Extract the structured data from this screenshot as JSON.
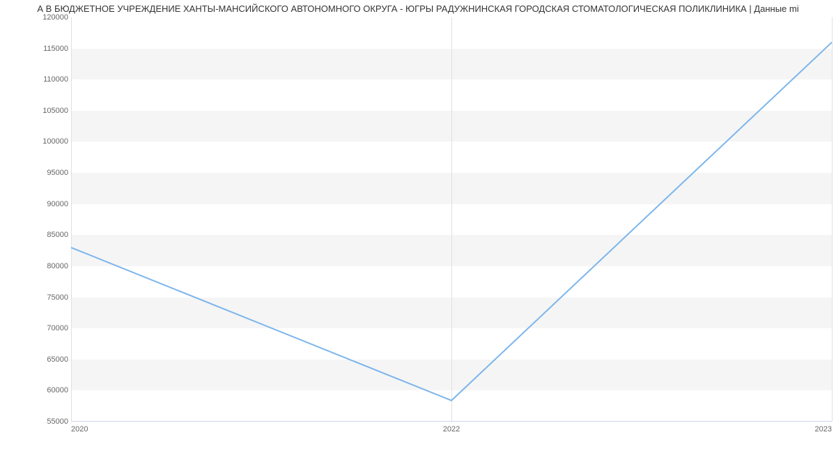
{
  "chart_data": {
    "type": "line",
    "title": "А В БЮДЖЕТНОЕ УЧРЕЖДЕНИЕ ХАНТЫ-МАНСИЙСКОГО АВТОНОМНОГО ОКРУГА - ЮГРЫ  РАДУЖНИНСКАЯ ГОРОДСКАЯ СТОМАТОЛОГИЧЕСКАЯ ПОЛИКЛИНИКА | Данные mi",
    "categories": [
      "2020",
      "2022",
      "2023"
    ],
    "values": [
      83000,
      58400,
      116000
    ],
    "xlabel": "",
    "ylabel": "",
    "ylim": [
      55000,
      120000
    ],
    "y_ticks": [
      55000,
      60000,
      65000,
      70000,
      75000,
      80000,
      85000,
      90000,
      95000,
      100000,
      105000,
      110000,
      115000,
      120000
    ]
  }
}
